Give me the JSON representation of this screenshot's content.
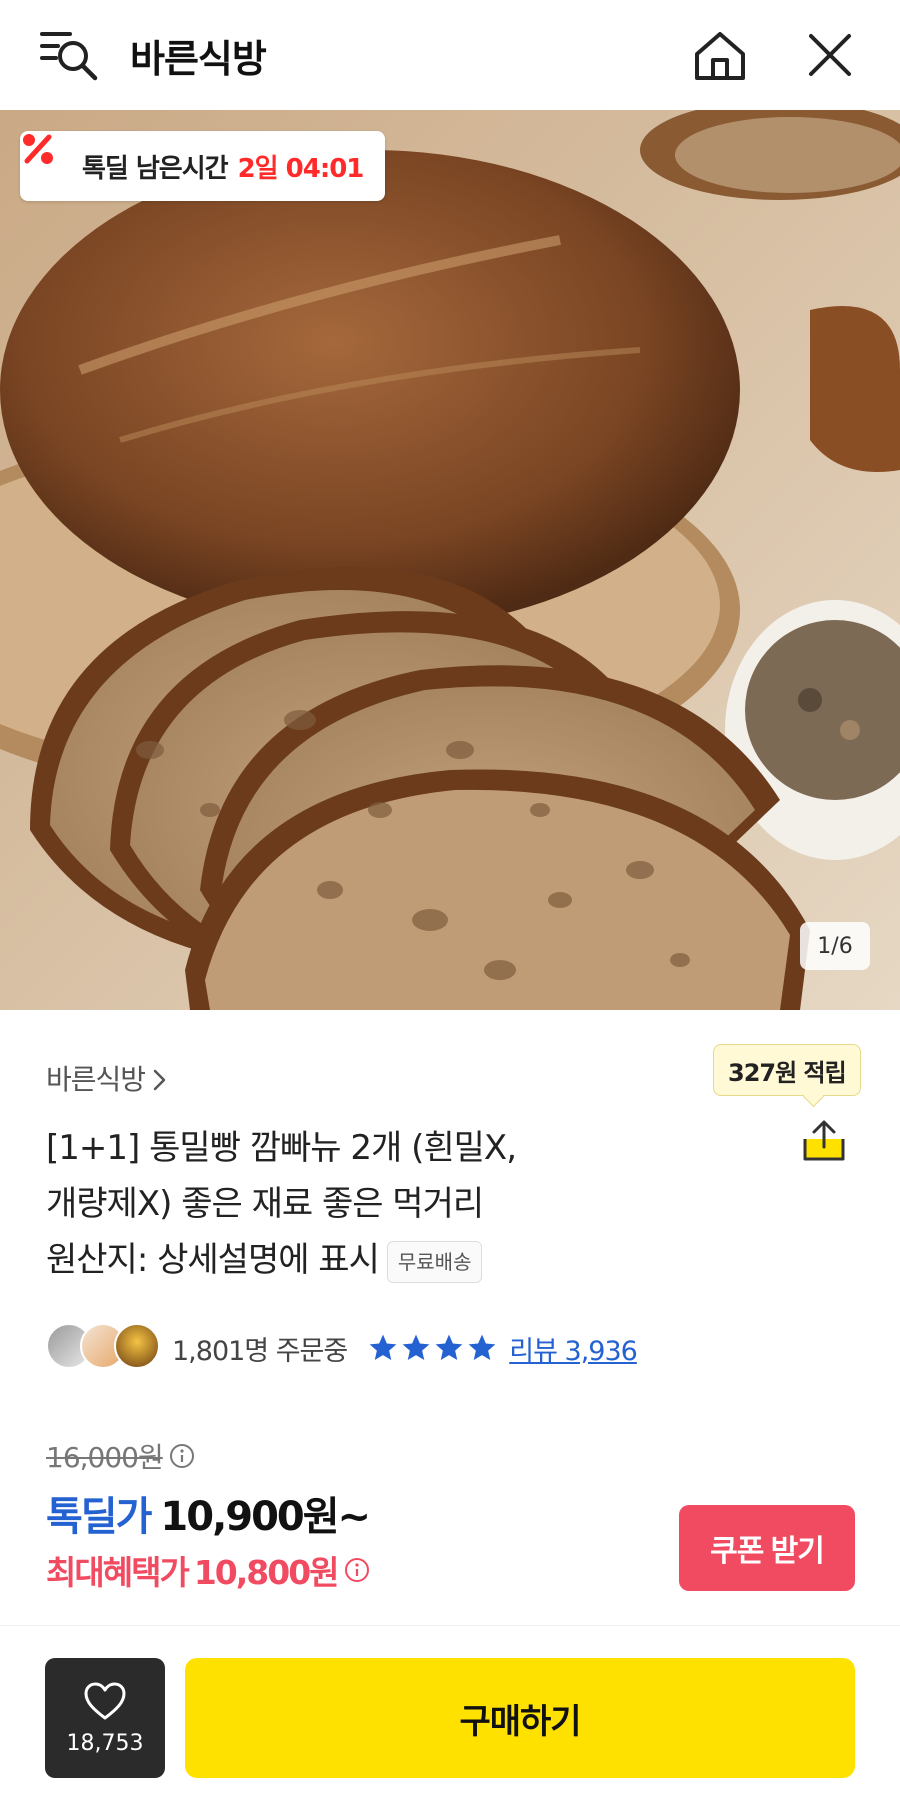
{
  "header": {
    "title": "바른식방"
  },
  "hero": {
    "deal_label": "톡딜 남은시간",
    "deal_time": "2일 04:01",
    "image_counter": "1/6"
  },
  "product": {
    "store_name": "바른식방",
    "points_tip": "327원 적립",
    "title_lines": [
      "[1+1] 통밀빵 깜빠뉴 2개 (흰밀X,",
      "개량제X) 좋은 재료 좋은 먹거리",
      "원산지: 상세설명에 표시"
    ],
    "free_shipping_badge": "무료배송",
    "order_count": "1,801명 주문중",
    "rating_stars": 4,
    "review_link": "리뷰 3,936"
  },
  "price": {
    "original": "16,000원",
    "deal_label": "톡딜가",
    "deal_value": "10,900원~",
    "max_label": "최대혜택가",
    "max_value": "10,800원",
    "coupon_button": "쿠폰 받기"
  },
  "bottom_bar": {
    "like_count": "18,753",
    "buy_button": "구매하기"
  },
  "colors": {
    "brand_yellow": "#ffe100",
    "deal_blue": "#2461d1",
    "benefit_red": "#f14b62",
    "timer_red": "#ff2a2a"
  }
}
